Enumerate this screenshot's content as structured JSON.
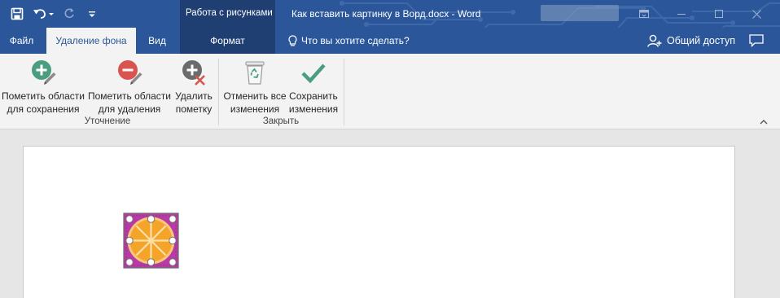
{
  "title_bar": {
    "context_group": "Работа с рисунками",
    "document_title": "Как вставить картинку в Ворд.docx - Word",
    "qat": {
      "save_icon": "save-icon",
      "undo_icon": "undo-icon",
      "redo_icon": "redo-icon",
      "customize_icon": "customize-qat-icon"
    },
    "window_controls": [
      "ribbon-display-options-icon",
      "minimize-icon",
      "maximize-icon",
      "close-icon"
    ]
  },
  "tabs": [
    {
      "label": "Файл"
    },
    {
      "label": "Удаление фона",
      "active": true
    },
    {
      "label": "Вид"
    },
    {
      "label": "Формат",
      "contextual": true
    }
  ],
  "tell_me": {
    "placeholder": "Что вы хотите сделать?",
    "icon": "lightbulb-icon"
  },
  "share": {
    "label": "Общий доступ",
    "icon": "person-add-icon"
  },
  "ribbon": {
    "groups": [
      {
        "label": "Уточнение",
        "buttons": [
          {
            "line1": "Пометить области",
            "line2": "для сохранения",
            "icon": "mark-keep-icon"
          },
          {
            "line1": "Пометить области",
            "line2": "для удаления",
            "icon": "mark-remove-icon"
          },
          {
            "line1": "Удалить",
            "line2": "пометку",
            "icon": "delete-mark-icon"
          }
        ]
      },
      {
        "label": "Закрыть",
        "buttons": [
          {
            "line1": "Отменить все",
            "line2": "изменения",
            "icon": "discard-icon"
          },
          {
            "line1": "Сохранить",
            "line2": "изменения",
            "icon": "keep-changes-icon"
          }
        ]
      }
    ]
  },
  "colors": {
    "title_bar": "#2b579a",
    "context_tab": "#1f3f73",
    "ribbon_bg": "#f3f3f3",
    "canvas_bg": "#e6e6e6",
    "keep_green": "#4a9e7f",
    "remove_red": "#d9534f",
    "removal_overlay": "#b51fa0",
    "orange": "#f5a42a"
  }
}
